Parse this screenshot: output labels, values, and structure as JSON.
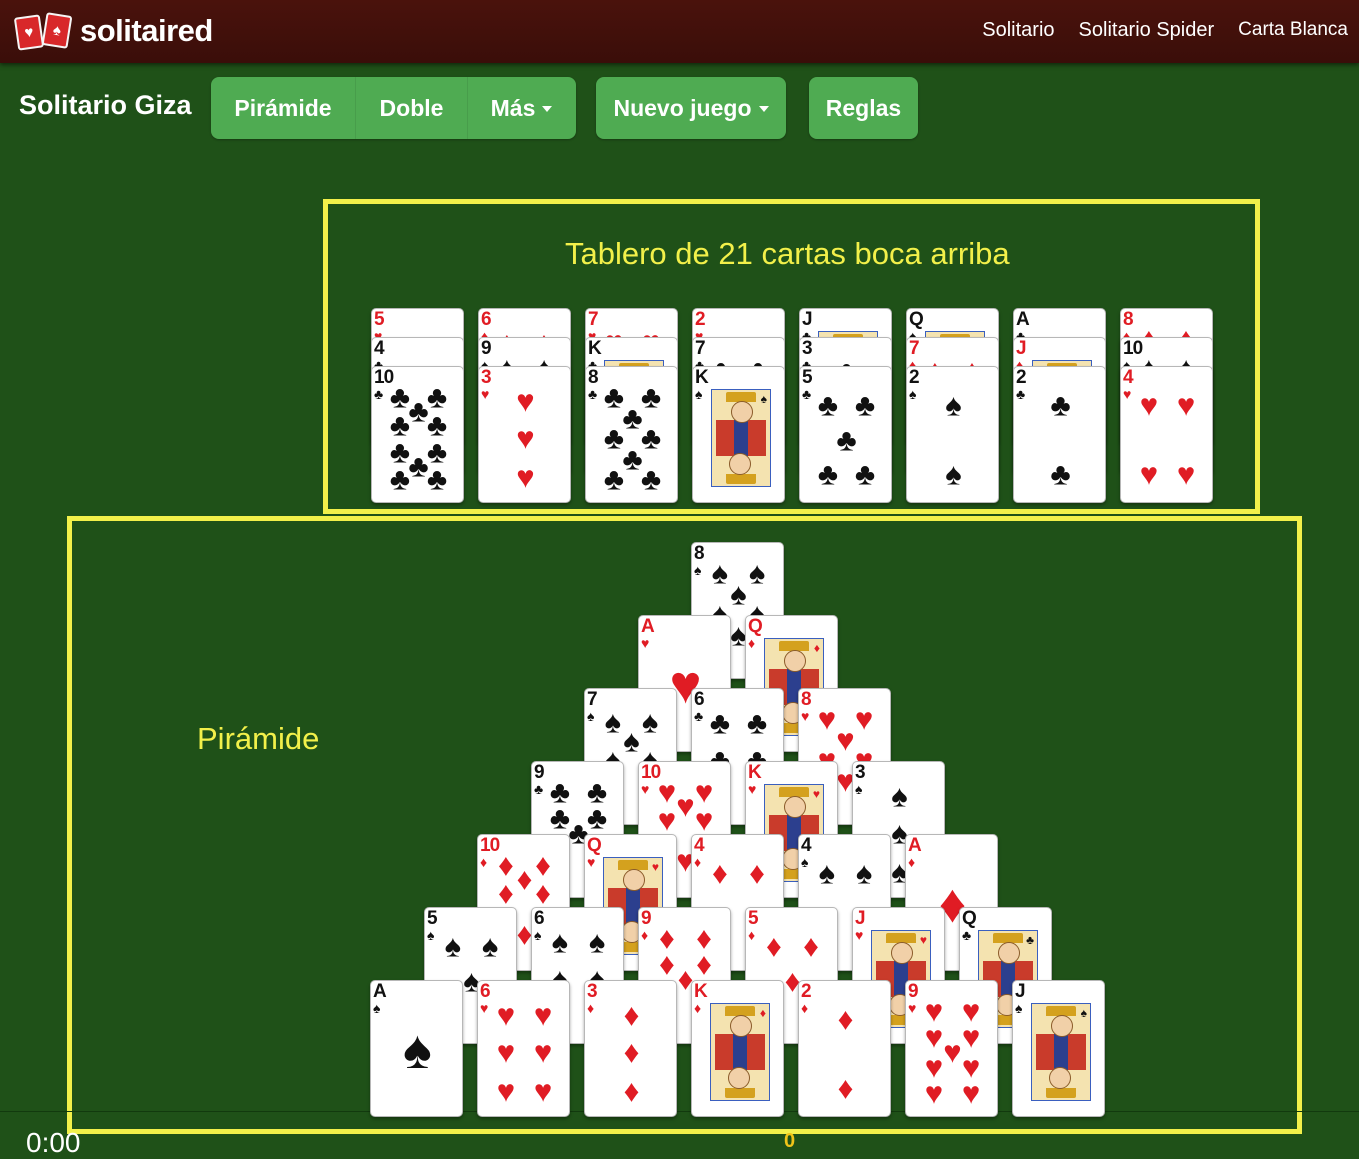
{
  "header": {
    "logo_text": "solitaired",
    "nav": [
      "Solitario",
      "Solitario Spider",
      "Carta Blanca"
    ]
  },
  "toolbar": {
    "title": "Solitario Giza",
    "variants": [
      "Pirámide",
      "Doble",
      "Más"
    ],
    "new_game": "Nuevo juego",
    "rules": "Reglas"
  },
  "annotations": {
    "tableau_label": "Tablero de 21 cartas boca arriba",
    "pyramid_label": "Pirámide",
    "highlight_color": "#f2f04a"
  },
  "colors": {
    "felt": "#1f5118",
    "header": "#3e0f0a",
    "button": "#4fab52",
    "red_suit": "#e01c24"
  },
  "tableau": [
    [
      "5♥",
      "4♣",
      "10♣"
    ],
    [
      "6♦",
      "9♠",
      "3♥"
    ],
    [
      "7♥",
      "K♣",
      "8♣"
    ],
    [
      "2♥",
      "7♣",
      "K♠"
    ],
    [
      "J♣",
      "3♣",
      "5♣"
    ],
    [
      "Q♠",
      "7♦",
      "2♠"
    ],
    [
      "A♣",
      "J♦",
      "2♣"
    ],
    [
      "8♦",
      "10♠",
      "4♥"
    ]
  ],
  "pyramid": [
    [
      "8♠"
    ],
    [
      "A♥",
      "Q♦"
    ],
    [
      "7♠",
      "6♣",
      "8♥"
    ],
    [
      "9♣",
      "10♥",
      "K♥",
      "3♠"
    ],
    [
      "10♦",
      "Q♥",
      "4♦",
      "4♠",
      "A♦"
    ],
    [
      "5♠",
      "6♠",
      "9♦",
      "5♦",
      "J♥",
      "Q♣"
    ],
    [
      "A♠",
      "6♥",
      "3♦",
      "K♦",
      "2♦",
      "9♥",
      "J♠"
    ]
  ],
  "status": {
    "timer": "0:00",
    "score": "0"
  }
}
